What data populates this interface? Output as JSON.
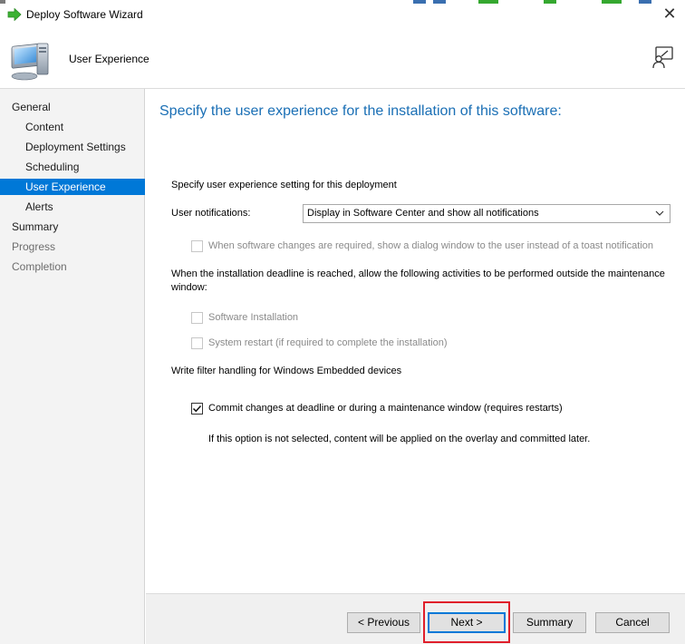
{
  "window": {
    "title": "Deploy Software Wizard",
    "page_name": "User Experience"
  },
  "icons": {
    "app": "green-arrow-icon",
    "close": "close-icon",
    "computer": "computer-icon",
    "help": "help-person-icon"
  },
  "nav": {
    "items": [
      {
        "label": "General",
        "level": 0,
        "state": "normal"
      },
      {
        "label": "Content",
        "level": 1,
        "state": "normal"
      },
      {
        "label": "Deployment Settings",
        "level": 1,
        "state": "normal"
      },
      {
        "label": "Scheduling",
        "level": 1,
        "state": "normal"
      },
      {
        "label": "User Experience",
        "level": 1,
        "state": "active"
      },
      {
        "label": "Alerts",
        "level": 1,
        "state": "normal"
      },
      {
        "label": "Summary",
        "level": 0,
        "state": "normal"
      },
      {
        "label": "Progress",
        "level": 0,
        "state": "disabled"
      },
      {
        "label": "Completion",
        "level": 0,
        "state": "disabled"
      }
    ]
  },
  "content": {
    "heading": "Specify the user experience for the installation of this software:",
    "specify_label": "Specify user experience setting for this deployment",
    "notifications_label": "User notifications:",
    "notifications_value": "Display in Software Center and show all notifications",
    "dialog_option": {
      "label": "When software changes are required, show a dialog window to the user instead of a toast notification",
      "checked": false,
      "enabled": false
    },
    "deadline_text_1": "When the installation deadline is reached, allow the following activities to be performed outside the maintenance",
    "deadline_text_2": "window:",
    "software_install": {
      "label": "Software Installation",
      "checked": false,
      "enabled": false
    },
    "system_restart": {
      "label": "System restart  (if required to complete the installation)",
      "checked": false,
      "enabled": false
    },
    "write_filter_label": "Write filter handling for Windows Embedded devices",
    "commit_changes": {
      "label": "Commit changes at deadline or during a maintenance window (requires restarts)",
      "checked": true,
      "enabled": true
    },
    "commit_note": "If this option is not selected, content will be applied on the overlay and committed later."
  },
  "footer": {
    "previous": "< Previous",
    "next": "Next >",
    "summary": "Summary",
    "cancel": "Cancel"
  },
  "colors": {
    "accent": "#0078d7",
    "heading": "#1a6fb5",
    "highlight": "#e01e2a"
  }
}
